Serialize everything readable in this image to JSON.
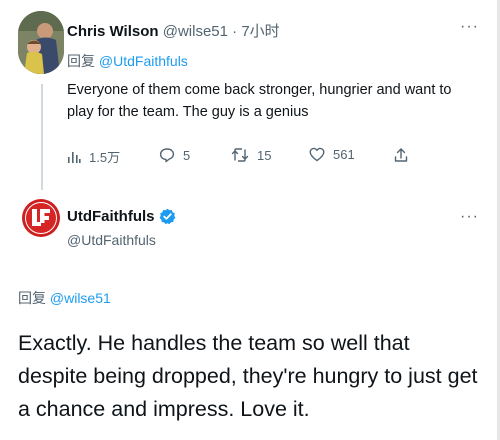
{
  "parent_tweet": {
    "author_name": "Chris Wilson",
    "author_handle": "@wilse51",
    "separator": "·",
    "time": "7小时",
    "reply_prefix": "回复",
    "reply_to": "@UtdFaithfuls",
    "text": "Everyone of them come back stronger, hungrier and want to play for the team. The guy is a genius",
    "more_label": "···",
    "actions": {
      "views": "1.5万",
      "replies": "5",
      "retweets": "15",
      "likes": "561"
    }
  },
  "reply_tweet": {
    "author_name": "UtdFaithfuls",
    "author_handle": "@UtdFaithfuls",
    "logo_text": "UF",
    "verified": true,
    "more_label": "···",
    "reply_prefix": "回复",
    "reply_to": "@wilse51",
    "text": "Exactly. He handles the team so well that despite being dropped, they're hungry to just get a chance and impress. Love it."
  },
  "colors": {
    "accent": "#1d9bf0",
    "secondary_text": "#536471",
    "primary_text": "#0f1419",
    "logo_red": "#d62525"
  }
}
